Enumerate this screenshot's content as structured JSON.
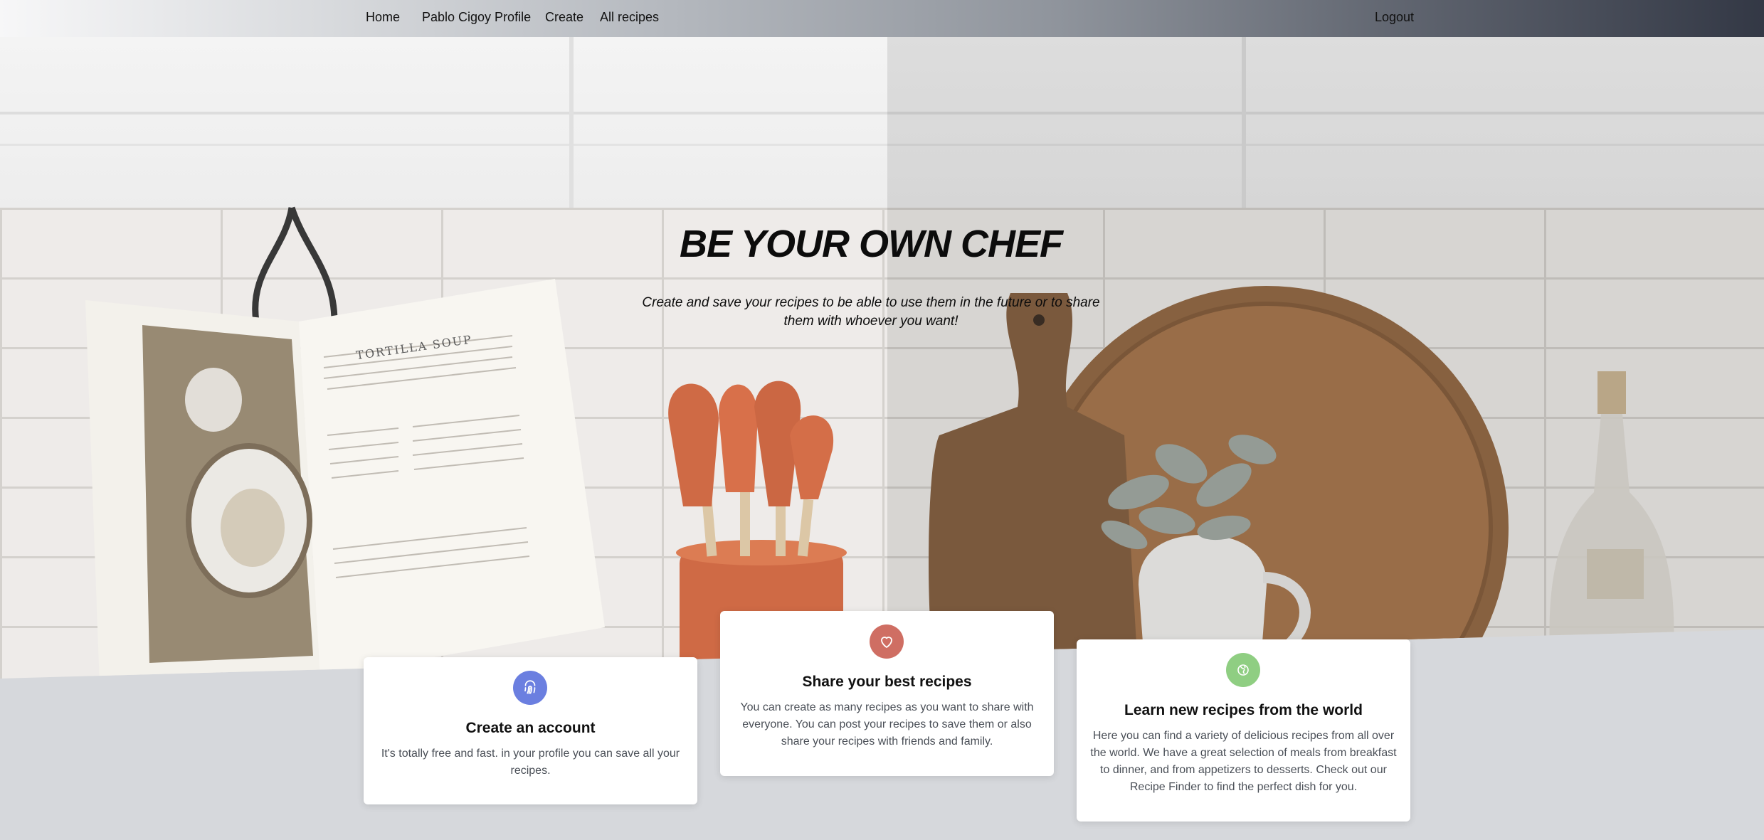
{
  "nav": {
    "home": "Home",
    "profile": "Pablo Cigoy Profile",
    "create": "Create",
    "all_recipes": "All recipes",
    "logout": "Logout"
  },
  "hero": {
    "title": "BE YOUR OWN CHEF",
    "subtitle": "Create and save your recipes to be able to use them in the future or to share them with whoever you want!",
    "book_title": "TORTILLA SOUP"
  },
  "cards": [
    {
      "icon": "fingerprint-icon",
      "icon_color": "#6b7fe0",
      "title": "Create an account",
      "text": "It's totally free and fast. in your profile you can save all your recipes."
    },
    {
      "icon": "heart-icon",
      "icon_color": "#cf6e63",
      "title": "Share your best recipes",
      "text": "You can create as many recipes as you want to share with everyone. You can post your recipes to save them or also share your recipes with friends and family."
    },
    {
      "icon": "globe-icon",
      "icon_color": "#8fce82",
      "title": "Learn new recipes from the world",
      "text": "Here you can find a variety of delicious recipes from all over the world. We have a great selection of meals from breakfast to dinner, and from appetizers to desserts. Check out our Recipe Finder to find the perfect dish for you."
    }
  ]
}
